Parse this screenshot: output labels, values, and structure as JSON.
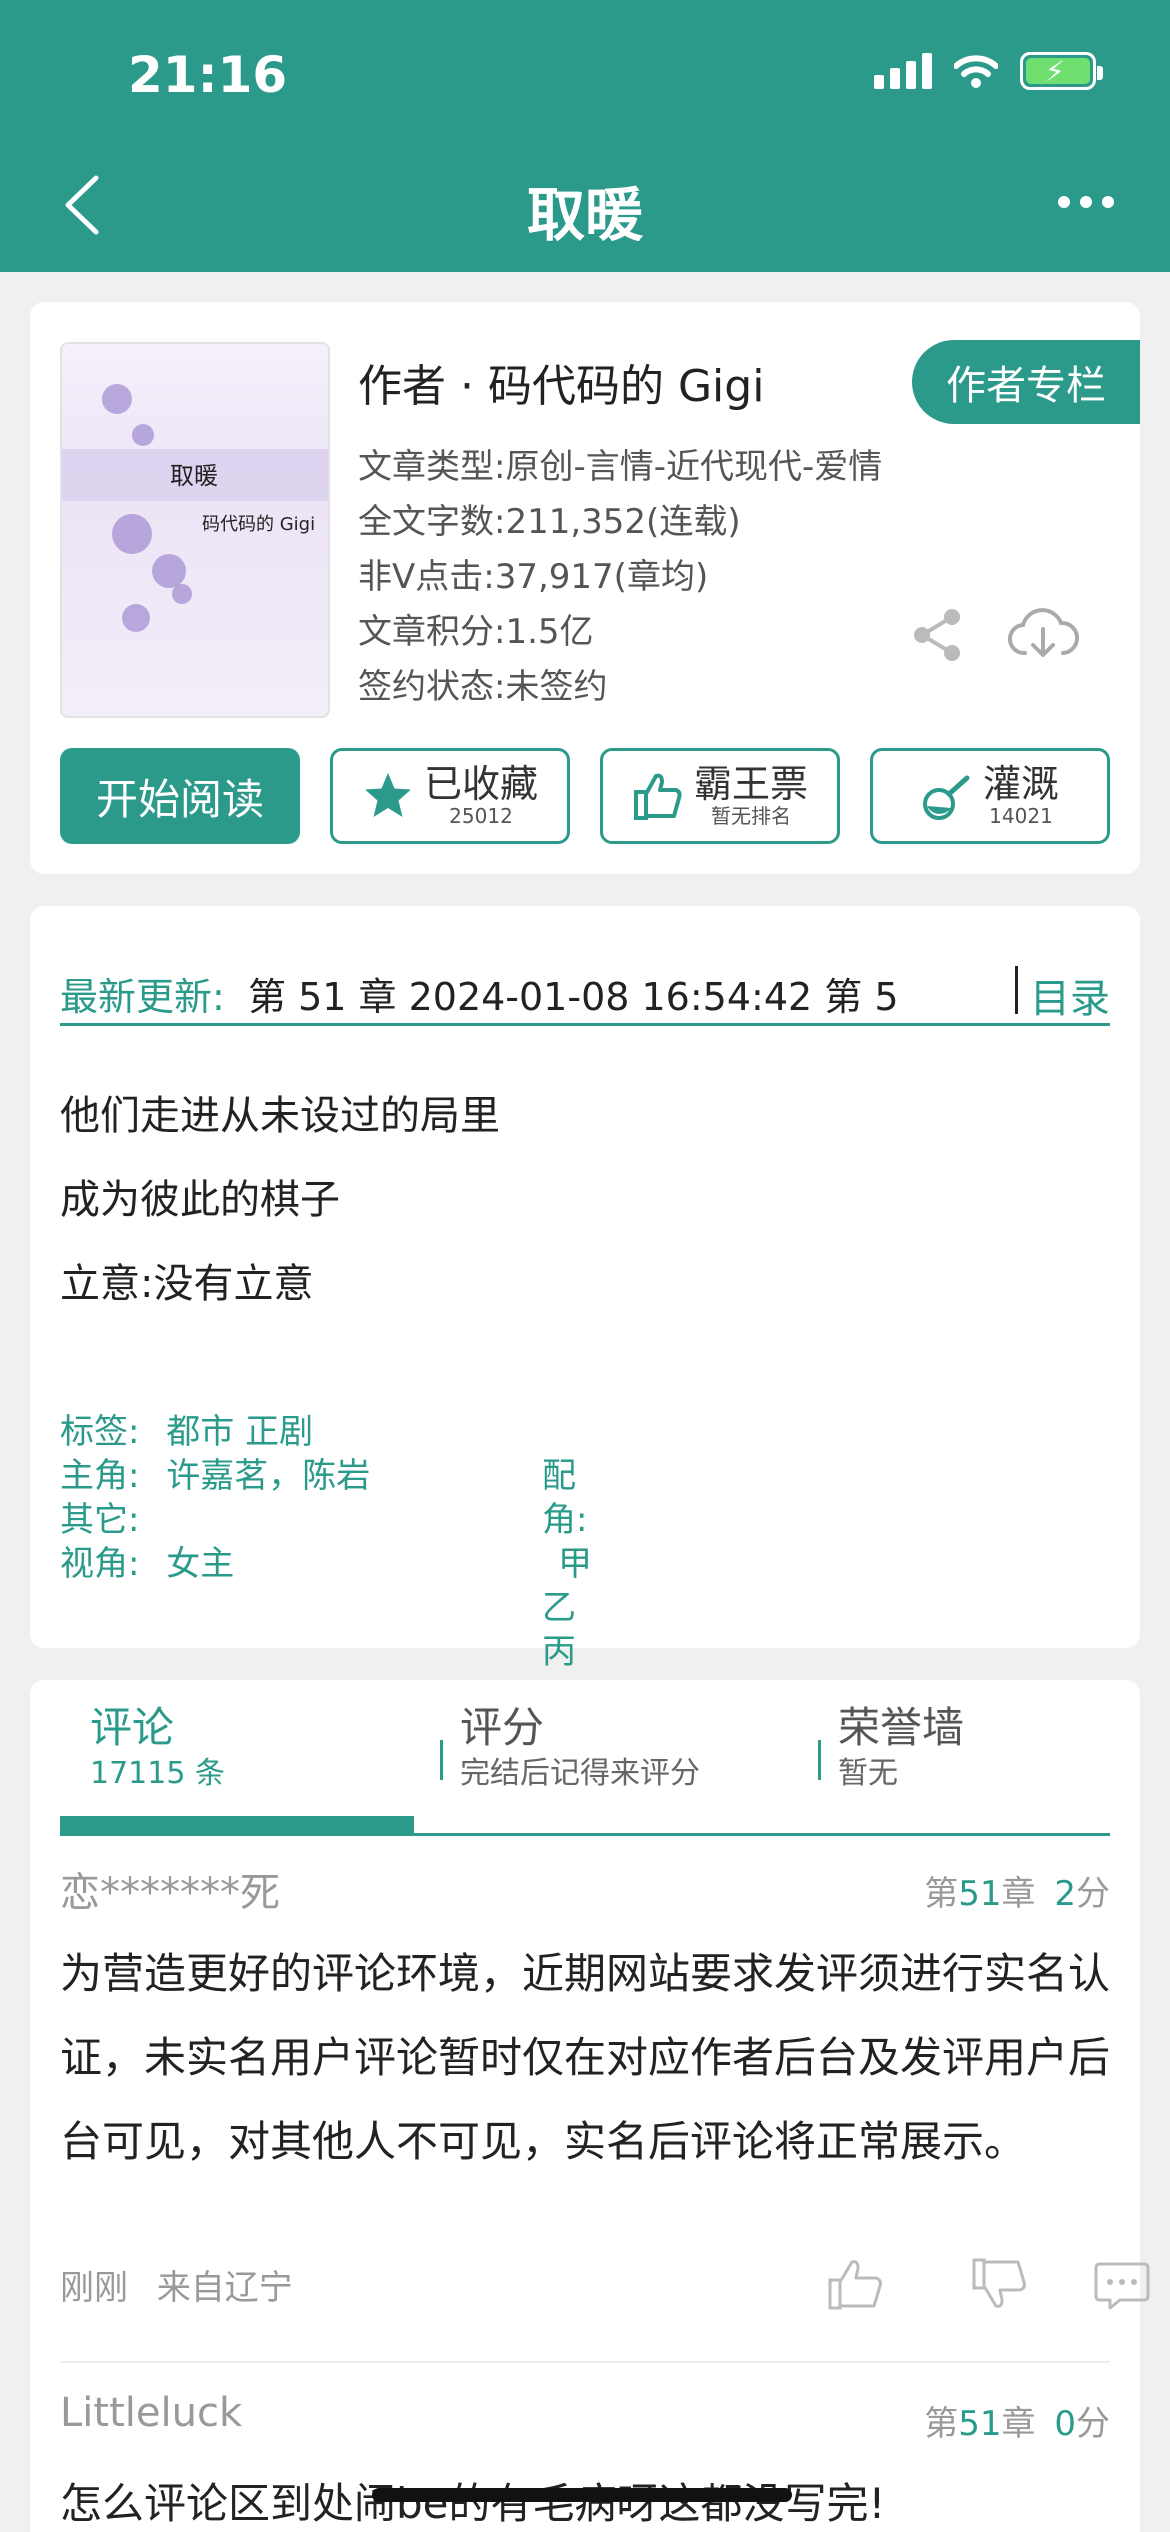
{
  "status_bar": {
    "time": "21:16"
  },
  "header": {
    "title": "取暖"
  },
  "book": {
    "cover_title": "取暖",
    "cover_author": "码代码的 Gigi",
    "author_line": "作者 · 码代码的 Gigi",
    "author_column_label": "作者专栏",
    "meta": [
      "文章类型:原创-言情-近代现代-爱情",
      "全文字数:211,352(连载)",
      "非Ⅴ点击:37,917(章均)",
      "文章积分:1.5亿",
      "签约状态:未签约"
    ],
    "start_reading_label": "开始阅读",
    "favorite": {
      "label": "已收藏",
      "count": "25012"
    },
    "overlord": {
      "label": "霸王票",
      "sub": "暂无排名"
    },
    "irrigate": {
      "label": "灌溉",
      "count": "14021"
    }
  },
  "intro": {
    "latest_label": "最新更新:",
    "latest_value": "第 51 章 2024-01-08 16:54:42  第 5",
    "toc_label": "目录",
    "lines": [
      "他们走进从未设过的局里",
      "成为彼此的棋子",
      "立意:没有立意"
    ],
    "tags_label": "标签:",
    "tags_value": "都市  正剧",
    "lead_label": "主角:",
    "lead_value": "许嘉茗，陈岩",
    "supporting_label": "配角:",
    "supporting_value": "甲乙丙丁",
    "other_label": "其它:",
    "pov_label": "视角:",
    "pov_value": "女主"
  },
  "comments_tabs": [
    {
      "title": "评论",
      "sub": "17115 条"
    },
    {
      "title": "评分",
      "sub": "完结后记得来评分"
    },
    {
      "title": "荣誉墙",
      "sub": "暂无"
    }
  ],
  "comments": [
    {
      "user": "恋*******死",
      "chapter_prefix": "第",
      "chapter": "51",
      "chapter_suffix": "章",
      "score": "2",
      "score_suffix": "分",
      "body": "为营造更好的评论环境，近期网站要求发评须进行实名认证，未实名用户评论暂时仅在对应作者后台及发评用户后台可见，对其他人不可见，实名后评论将正常展示。",
      "time": "刚刚",
      "location": "来自辽宁"
    },
    {
      "user": "Littleluck",
      "chapter_prefix": "第",
      "chapter": "51",
      "chapter_suffix": "章",
      "score": "0",
      "score_suffix": "分",
      "body": "怎么评论区到处闹be的有毛病呀这都没写完!"
    }
  ],
  "colors": {
    "accent": "#2b9a8b",
    "background": "#f0f0f0"
  }
}
